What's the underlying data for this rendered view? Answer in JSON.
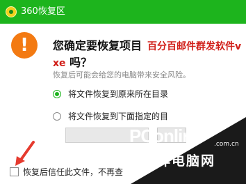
{
  "window": {
    "title": "360恢复区"
  },
  "icon": {
    "name": "warning-icon",
    "glyph": "!",
    "color": "#f37a12"
  },
  "dialog": {
    "question_line1": "您确定要恢复项目",
    "filename_part1": "百分百邮件群发软件v",
    "filename_part2": "xe",
    "question_line2": "吗？",
    "subtitle": "恢复后可能会给您的电脑带来安全风险。"
  },
  "options": [
    {
      "label": "将文件恢复到原来所在目录",
      "selected": true
    },
    {
      "label": "将文件恢复到下面指定的目",
      "selected": false
    }
  ],
  "trust_checkbox": {
    "label": "恢复后信任此文件，不再查",
    "checked": false
  },
  "watermark": {
    "brand": "PConline",
    "domain": ".com.cn",
    "tagline": "太平洋电脑网"
  },
  "colors": {
    "title_bar": "#1db41d",
    "accent_red": "#d1201a",
    "arrow": "#e53a2e"
  }
}
